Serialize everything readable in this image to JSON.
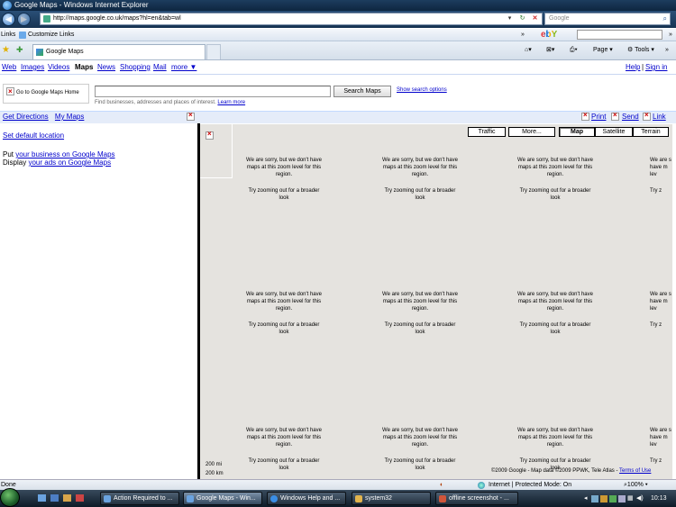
{
  "window": {
    "title": "Google Maps - Windows Internet Explorer"
  },
  "browser": {
    "address": "http://maps.google.co.uk/maps?hl=en&tab=wl",
    "search_placeholder": "Google",
    "links_label": "Links",
    "customize_links": "Customize Links",
    "ebay_logo": "ebY",
    "tab_title": "Google Maps",
    "tools": {
      "page": "Page",
      "tools": "Tools"
    },
    "nav_back": "◀",
    "nav_forward": "▶"
  },
  "google_nav": {
    "items": [
      {
        "label": "Web"
      },
      {
        "label": "Images"
      },
      {
        "label": "Videos"
      },
      {
        "label": "Maps"
      },
      {
        "label": "News"
      },
      {
        "label": "Shopping"
      },
      {
        "label": "Mail"
      },
      {
        "label": "more ▼"
      }
    ],
    "help": "Help",
    "signin": "Sign in",
    "separator": "|"
  },
  "search": {
    "go_home": "Go to Google Maps Home",
    "button": "Search Maps",
    "show_options": "Show search options",
    "hint": "Find businesses, addresses and places of interest.",
    "learn_more": "Learn more"
  },
  "side": {
    "get_directions": "Get Directions",
    "my_maps": "My Maps",
    "set_default": "Set default location",
    "put_prefix": "Put ",
    "put_link": "your business on Google Maps",
    "display_prefix": "Display ",
    "display_link": "your ads on Google Maps"
  },
  "right_tools": {
    "print": "Print",
    "send": "Send",
    "link": "Link"
  },
  "map": {
    "buttons": {
      "traffic": "Traffic",
      "more": "More...",
      "map": "Map",
      "satellite": "Satellite",
      "terrain": "Terrain"
    },
    "tile_msg1": "We are sorry, but we don't have maps at this zoom level for this region.",
    "tile_msg2": "Try zooming out for a broader look",
    "tile_msg1_clip": "We are s have m lev",
    "tile_msg2_clip": "Try z",
    "scale_mi": "200 mi",
    "scale_km": "200 km",
    "copyright": "©2009 Google - Map data ©2009 PPWK, Tele Atlas - ",
    "terms": "Terms of Use"
  },
  "status": {
    "left": "Done",
    "zone": "Internet | Protected Mode: On",
    "zoom": "100%"
  },
  "taskbar": {
    "buttons": [
      {
        "label": "Action Required to ..."
      },
      {
        "label": "Google Maps - Win..."
      },
      {
        "label": "Windows Help and ..."
      },
      {
        "label": "system32"
      },
      {
        "label": "offline screenshot - ..."
      }
    ],
    "clock": "10:13"
  }
}
